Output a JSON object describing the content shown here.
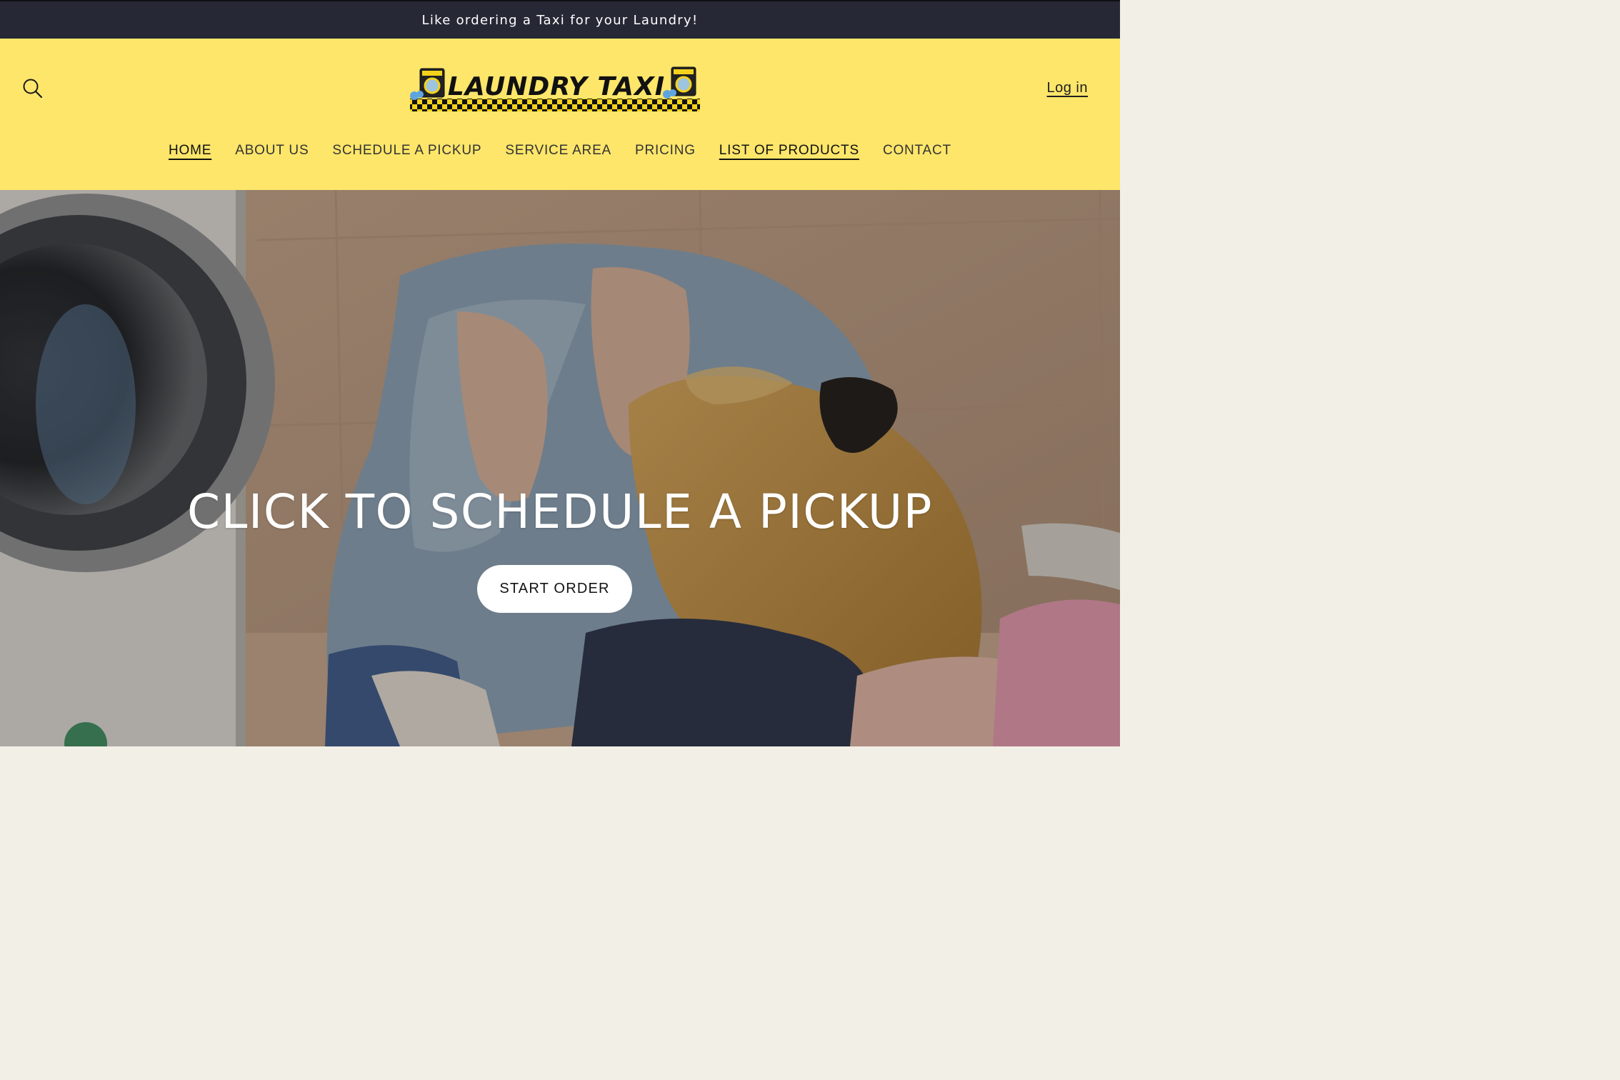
{
  "announcement": {
    "text": "Like ordering a Taxi for your Laundry!"
  },
  "header": {
    "logo_text": "LAUNDRY TAXI",
    "login_label": "Log in",
    "search_icon": "search-icon"
  },
  "nav": {
    "items": [
      {
        "label": "HOME"
      },
      {
        "label": "ABOUT US"
      },
      {
        "label": "SCHEDULE A PICKUP"
      },
      {
        "label": "SERVICE AREA"
      },
      {
        "label": "PRICING"
      },
      {
        "label": "LIST OF PRODUCTS"
      },
      {
        "label": "CONTACT"
      }
    ]
  },
  "hero": {
    "heading": "CLICK TO SCHEDULE A PICKUP",
    "button_label": "START ORDER"
  },
  "colors": {
    "announcement_bg": "#262835",
    "header_bg": "#fde66a",
    "button_bg": "#ffffff",
    "hero_text": "#ffffff"
  }
}
